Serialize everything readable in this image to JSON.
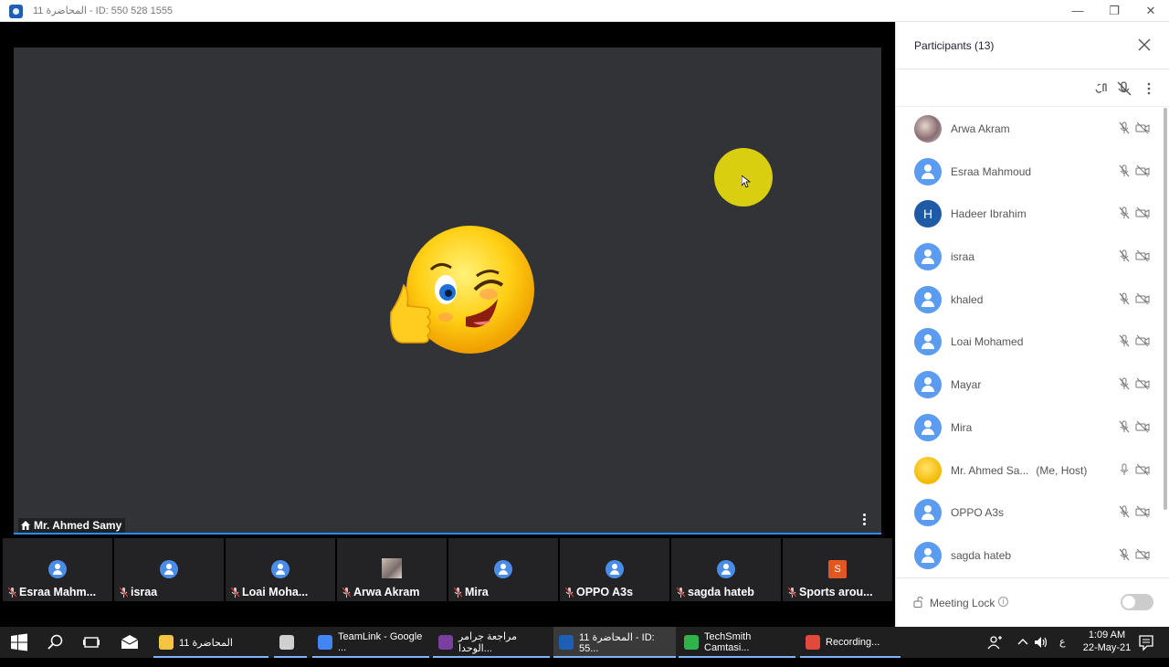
{
  "window": {
    "title": "المحاضرة 11 - ID: 550 528 1555",
    "minimize": "—",
    "maximize": "❐",
    "close": "✕"
  },
  "main_video": {
    "speaker_name": "Mr. Ahmed Samy"
  },
  "thumbnails": [
    {
      "name": "Esraa Mahm...",
      "avatar": "generic"
    },
    {
      "name": "israa",
      "avatar": "generic"
    },
    {
      "name": "Loai Moha...",
      "avatar": "generic"
    },
    {
      "name": "Arwa Akram",
      "avatar": "photo"
    },
    {
      "name": "Mira",
      "avatar": "generic"
    },
    {
      "name": "OPPO A3s",
      "avatar": "generic"
    },
    {
      "name": "sagda hateb",
      "avatar": "generic"
    },
    {
      "name": "Sports arou...",
      "avatar": "S"
    }
  ],
  "participants_panel": {
    "title": "Participants (13)",
    "participants": [
      {
        "name": "Arwa Akram",
        "role": "",
        "avatar": "photo",
        "mic": "muted",
        "video": "off"
      },
      {
        "name": "Esraa Mahmoud",
        "role": "",
        "avatar": "generic",
        "mic": "muted",
        "video": "off"
      },
      {
        "name": "Hadeer Ibrahim",
        "role": "",
        "avatar": "H",
        "mic": "muted",
        "video": "off"
      },
      {
        "name": "israa",
        "role": "",
        "avatar": "generic",
        "mic": "muted",
        "video": "off"
      },
      {
        "name": "khaled",
        "role": "",
        "avatar": "generic",
        "mic": "muted",
        "video": "off"
      },
      {
        "name": "Loai Mohamed",
        "role": "",
        "avatar": "generic",
        "mic": "muted",
        "video": "off"
      },
      {
        "name": "Mayar",
        "role": "",
        "avatar": "generic",
        "mic": "muted",
        "video": "off"
      },
      {
        "name": "Mira",
        "role": "",
        "avatar": "generic",
        "mic": "muted",
        "video": "off"
      },
      {
        "name": "Mr. Ahmed Sa...",
        "role": "(Me, Host)",
        "avatar": "emoji",
        "mic": "on",
        "video": "off"
      },
      {
        "name": "OPPO A3s",
        "role": "",
        "avatar": "generic",
        "mic": "muted",
        "video": "off"
      },
      {
        "name": "sagda hateb",
        "role": "",
        "avatar": "generic",
        "mic": "muted",
        "video": "off"
      }
    ],
    "footer": {
      "lock_label": "Meeting Lock",
      "lock_enabled": false
    }
  },
  "taskbar": {
    "items": [
      {
        "label": "المحاضرة 11",
        "icon": "folder-icon",
        "color": "#f5c542"
      },
      {
        "label": "",
        "icon": "calculator-icon",
        "color": "#cfcfcf"
      },
      {
        "label": "TeamLink - Google ...",
        "icon": "chrome-icon",
        "color": "#4285f4"
      },
      {
        "label": "مراجعة جرامر الوحدا...",
        "icon": "pdf-icon",
        "color": "#7b3fa0"
      },
      {
        "label": "المحاضرة 11 - ID: 55...",
        "icon": "teamlink-icon",
        "color": "#1d5fb5"
      },
      {
        "label": "TechSmith Camtasi...",
        "icon": "camtasia-icon",
        "color": "#2fb34a"
      },
      {
        "label": "Recording...",
        "icon": "recording-icon",
        "color": "#e3493a"
      }
    ],
    "tray": {
      "language": "ع",
      "time": "1:09 AM",
      "date": "22-May-21",
      "notifications": "1"
    }
  }
}
